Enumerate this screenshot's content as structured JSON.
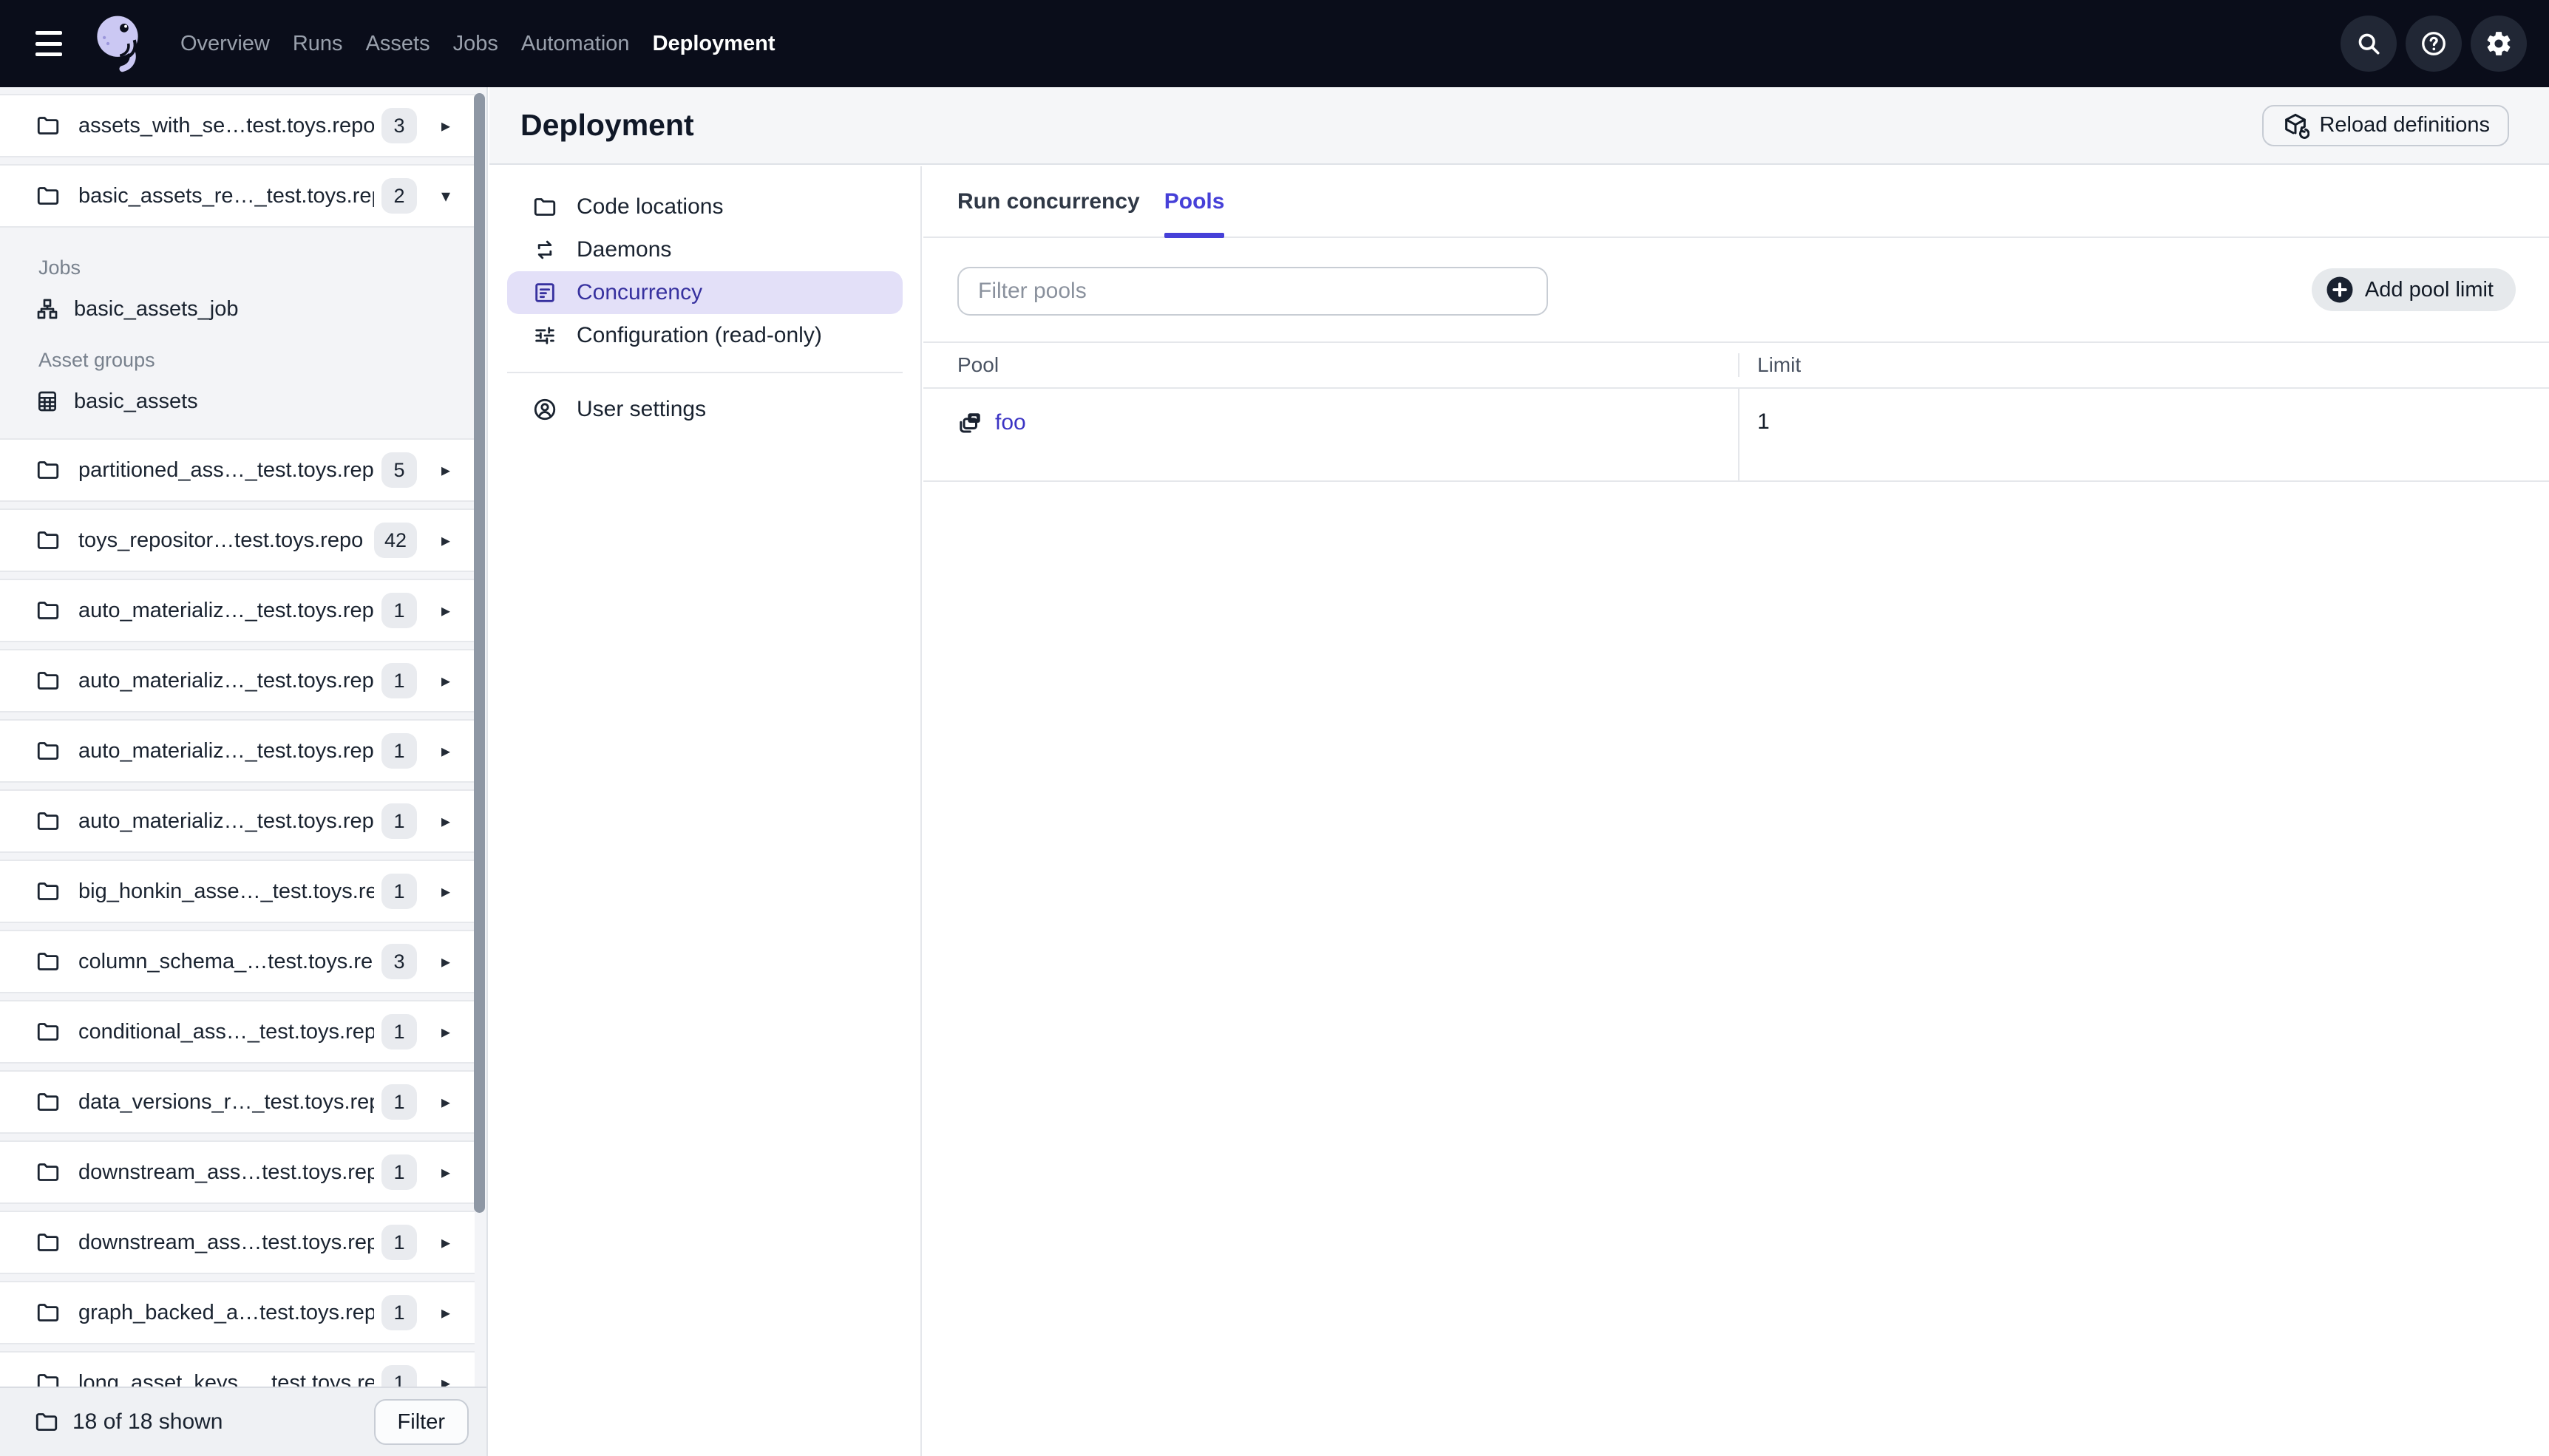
{
  "topnav": {
    "items": [
      {
        "label": "Overview"
      },
      {
        "label": "Runs"
      },
      {
        "label": "Assets"
      },
      {
        "label": "Jobs"
      },
      {
        "label": "Automation"
      },
      {
        "label": "Deployment",
        "active": true
      }
    ]
  },
  "sidebar": {
    "rows": [
      {
        "label": "assets_with_se…test.toys.repo",
        "count": "3",
        "state": "collapsed"
      },
      {
        "label": "basic_assets_re…_test.toys.rep",
        "count": "2",
        "state": "expanded"
      },
      {
        "label": "partitioned_ass…_test.toys.rep",
        "count": "5",
        "state": "collapsed"
      },
      {
        "label": "toys_repositor…test.toys.repo",
        "count": "42",
        "state": "collapsed"
      },
      {
        "label": "auto_materializ…_test.toys.repo",
        "count": "1",
        "state": "collapsed"
      },
      {
        "label": "auto_materializ…_test.toys.repo",
        "count": "1",
        "state": "collapsed"
      },
      {
        "label": "auto_materializ…_test.toys.repo",
        "count": "1",
        "state": "collapsed"
      },
      {
        "label": "auto_materializ…_test.toys.repo",
        "count": "1",
        "state": "collapsed"
      },
      {
        "label": "big_honkin_asse…_test.toys.rep",
        "count": "1",
        "state": "collapsed"
      },
      {
        "label": "column_schema_…test.toys.rep",
        "count": "3",
        "state": "collapsed"
      },
      {
        "label": "conditional_ass…_test.toys.repo",
        "count": "1",
        "state": "collapsed"
      },
      {
        "label": "data_versions_r…_test.toys.rep",
        "count": "1",
        "state": "collapsed"
      },
      {
        "label": "downstream_ass…test.toys.rep",
        "count": "1",
        "state": "collapsed"
      },
      {
        "label": "downstream_ass…test.toys.rep",
        "count": "1",
        "state": "collapsed"
      },
      {
        "label": "graph_backed_a…test.toys.repo",
        "count": "1",
        "state": "collapsed"
      },
      {
        "label": "long_asset_keys_…test.toys.rep",
        "count": "1",
        "state": "collapsed"
      }
    ],
    "expanded": {
      "jobs_header": "Jobs",
      "jobs": [
        "basic_assets_job"
      ],
      "groups_header": "Asset groups",
      "groups": [
        "basic_assets"
      ]
    },
    "footer": {
      "summary": "18 of 18 shown",
      "filter_label": "Filter"
    }
  },
  "header": {
    "title": "Deployment",
    "reload_label": "Reload definitions"
  },
  "subnav": {
    "items": [
      {
        "label": "Code locations"
      },
      {
        "label": "Daemons"
      },
      {
        "label": "Concurrency",
        "active": true
      },
      {
        "label": "Configuration (read-only)"
      }
    ],
    "user_settings": "User settings"
  },
  "main": {
    "tabs": [
      {
        "label": "Run concurrency"
      },
      {
        "label": "Pools",
        "active": true
      }
    ],
    "filter_placeholder": "Filter pools",
    "add_button_label": "Add pool limit",
    "table": {
      "columns": [
        "Pool",
        "Limit"
      ],
      "rows": [
        {
          "pool": "foo",
          "limit": "1"
        }
      ]
    }
  },
  "colors": {
    "topnav_bg": "#0A0D1A",
    "accent": "#4640D8",
    "selected_item_bg": "#E3E0F8",
    "selected_item_text": "#37319F",
    "header_band_bg": "#F5F6F8",
    "sidebar_bg": "#F3F4F7",
    "badge_bg": "#E9EBEF",
    "link": "#3B34C4"
  }
}
